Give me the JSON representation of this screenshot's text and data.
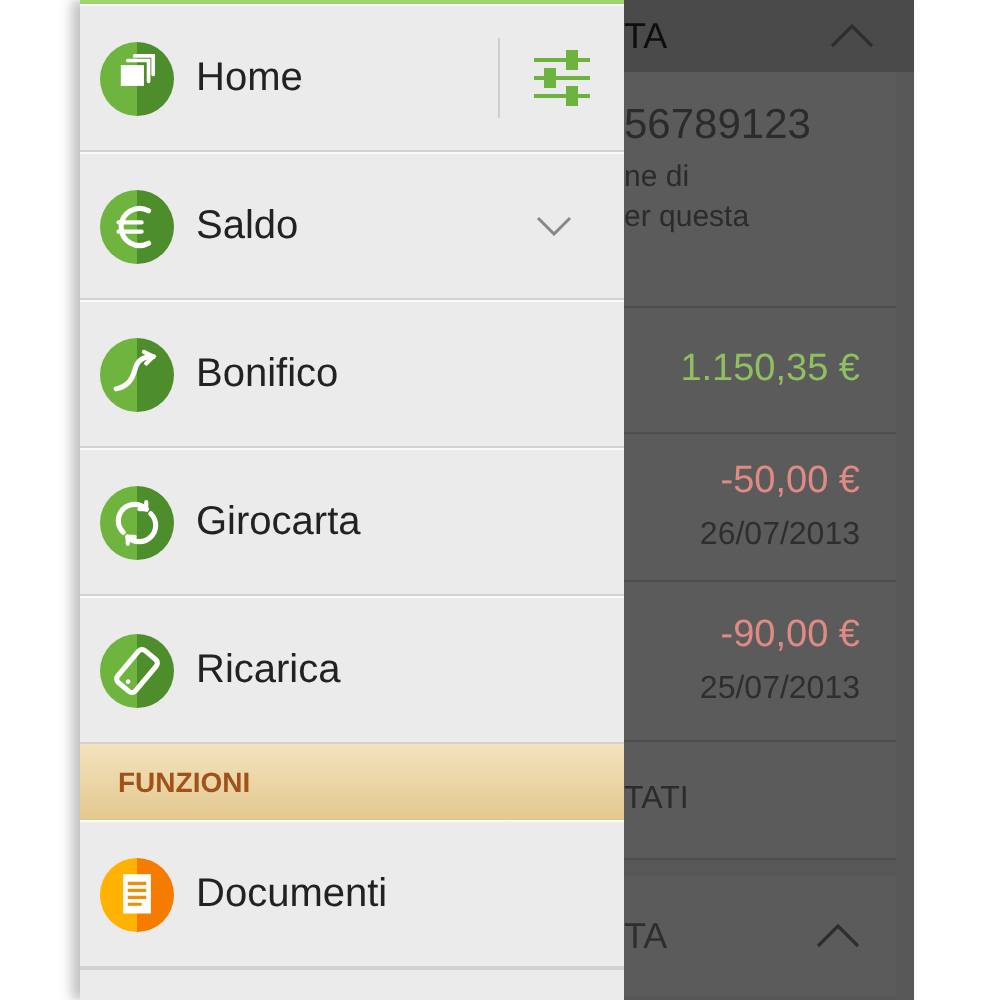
{
  "background": {
    "sections": [
      {
        "title": "TA",
        "expanded": true,
        "account": {
          "number": "56789123",
          "lines": [
            "ne di",
            "er questa"
          ]
        },
        "movements": [
          {
            "kind": "credit",
            "amount": "1.150,35 €"
          },
          {
            "kind": "debit",
            "amount": "-50,00 €",
            "date": "26/07/2013"
          },
          {
            "kind": "debit",
            "amount": "-90,00 €",
            "date": "25/07/2013"
          }
        ],
        "link": "TATI"
      },
      {
        "title": "TA",
        "expanded": true
      }
    ]
  },
  "drawer": {
    "sections": [
      {
        "items": [
          {
            "kind": "home",
            "label": "Home",
            "settings_button": true
          },
          {
            "kind": "euro",
            "label": "Saldo",
            "expandable": true,
            "expanded": false
          },
          {
            "kind": "transfer",
            "label": "Bonifico"
          },
          {
            "kind": "swap",
            "label": "Girocarta"
          },
          {
            "kind": "phone",
            "label": "Ricarica"
          }
        ]
      },
      {
        "header": "FUNZIONI",
        "items": [
          {
            "kind": "documents",
            "label": "Documenti"
          },
          {
            "kind": "blank"
          }
        ]
      }
    ]
  }
}
